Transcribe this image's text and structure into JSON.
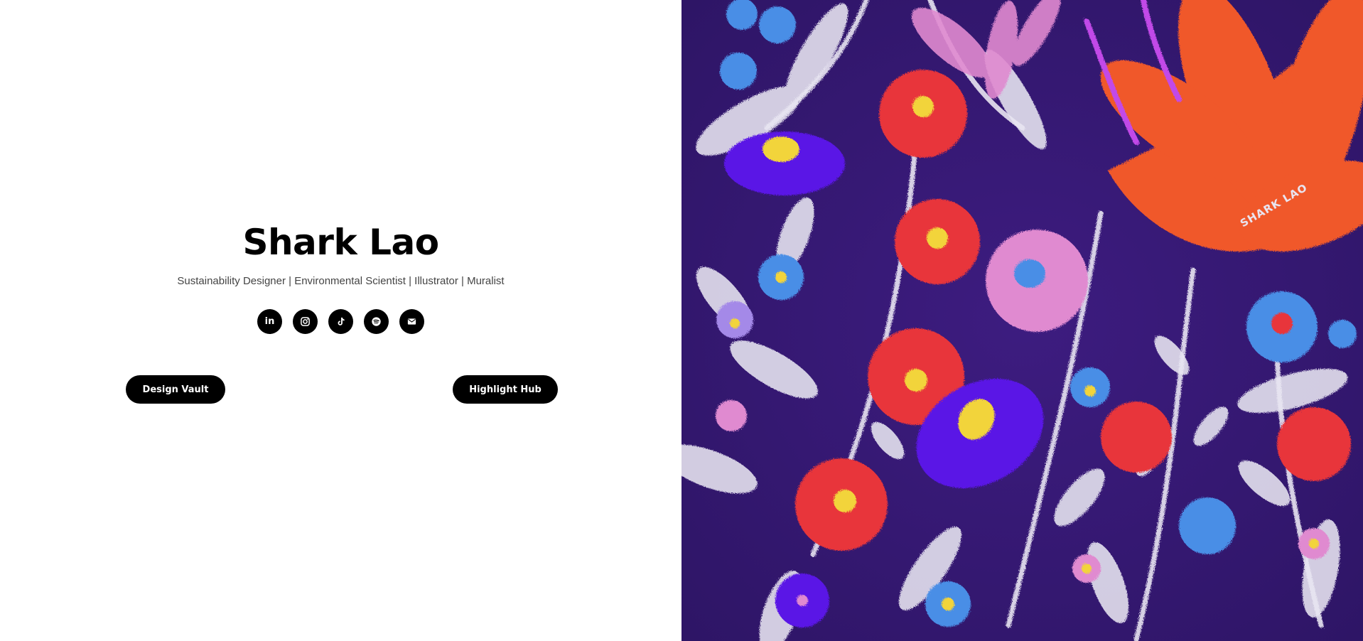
{
  "profile": {
    "name": "Shark Lao",
    "tagline": "Sustainability Designer | Environmental Scientist | Illustrator | Muralist"
  },
  "social_links": [
    {
      "icon": "linkedin-icon",
      "glyph": "in"
    },
    {
      "icon": "instagram-icon"
    },
    {
      "icon": "tiktok-icon"
    },
    {
      "icon": "spotify-icon"
    },
    {
      "icon": "email-icon"
    }
  ],
  "buttons": {
    "design_vault": "Design Vault",
    "highlight_hub": "Highlight Hub"
  },
  "artwork": {
    "description_icon": "floral-pastel-illustration",
    "signature": "SHARK LAO",
    "colors": {
      "background": "#3b1a7a",
      "red": "#e8343a",
      "orange": "#f0582c",
      "pink": "#e08ad0",
      "white": "#e9e6f2",
      "violet": "#5a12e6",
      "blue": "#4a8ee6",
      "yellow": "#f2d43a"
    }
  }
}
